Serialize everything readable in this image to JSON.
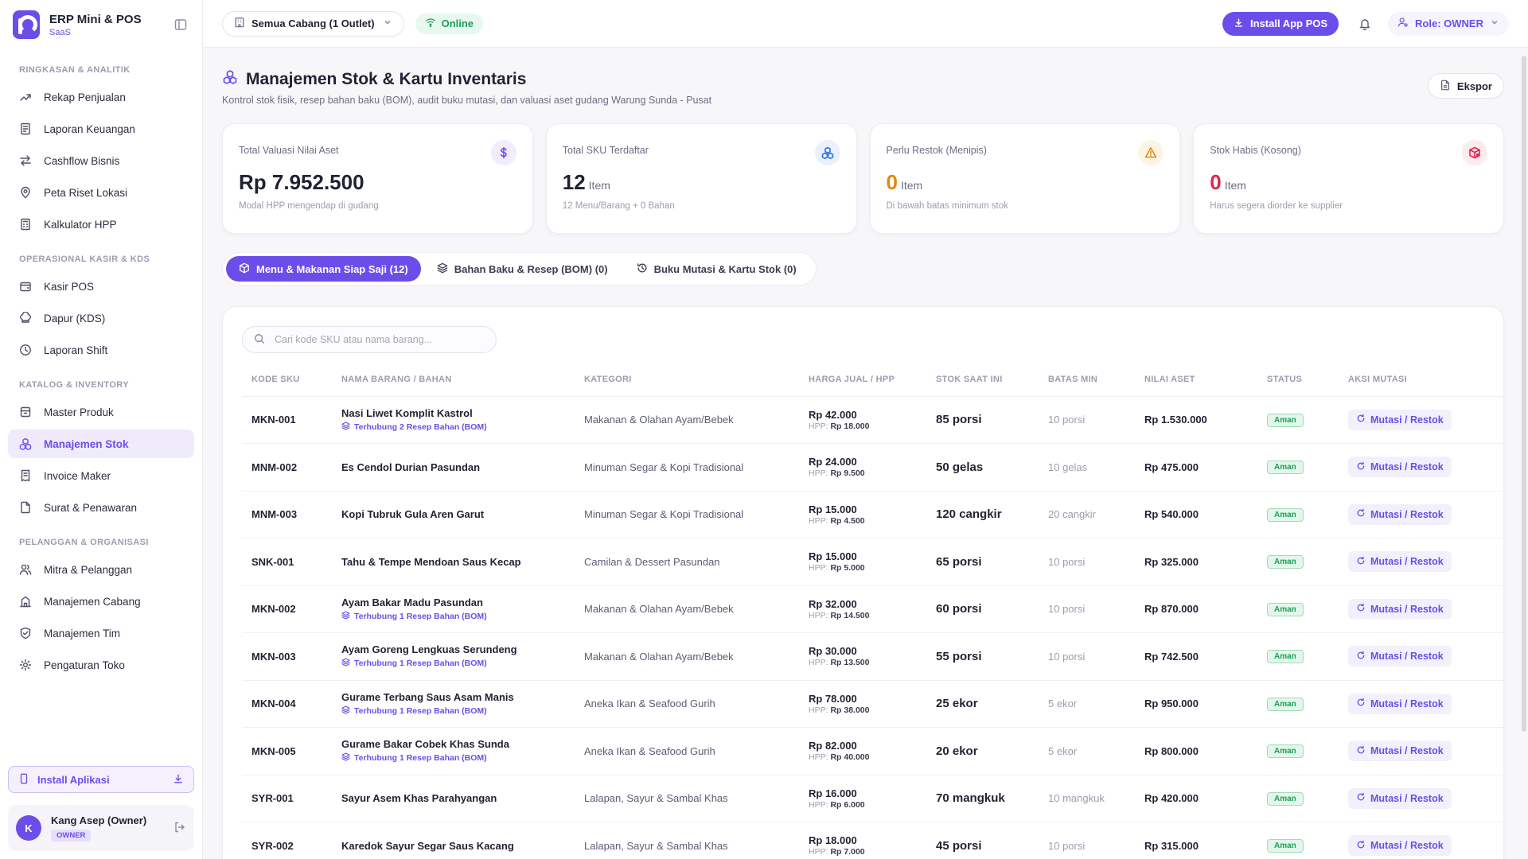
{
  "brand": {
    "title": "ERP Mini & POS",
    "subtitle": "SaaS"
  },
  "sidebar": {
    "sections": [
      {
        "title": "RINGKASAN & ANALITIK",
        "items": [
          {
            "label": "Rekap Penjualan",
            "icon": "trend-icon"
          },
          {
            "label": "Laporan Keuangan",
            "icon": "document-icon"
          },
          {
            "label": "Cashflow Bisnis",
            "icon": "transfer-icon"
          },
          {
            "label": "Peta Riset Lokasi",
            "icon": "map-pin-icon"
          },
          {
            "label": "Kalkulator HPP",
            "icon": "calculator-icon"
          }
        ]
      },
      {
        "title": "OPERASIONAL KASIR & KDS",
        "items": [
          {
            "label": "Kasir POS",
            "icon": "wallet-icon"
          },
          {
            "label": "Dapur (KDS)",
            "icon": "chef-hat-icon"
          },
          {
            "label": "Laporan Shift",
            "icon": "clock-icon"
          }
        ]
      },
      {
        "title": "KATALOG & INVENTORY",
        "items": [
          {
            "label": "Master Produk",
            "icon": "box-icon"
          },
          {
            "label": "Manajemen Stok",
            "icon": "boxes-icon"
          },
          {
            "label": "Invoice Maker",
            "icon": "receipt-icon"
          },
          {
            "label": "Surat & Penawaran",
            "icon": "file-icon"
          }
        ]
      },
      {
        "title": "PELANGGAN & ORGANISASI",
        "items": [
          {
            "label": "Mitra & Pelanggan",
            "icon": "users-icon"
          },
          {
            "label": "Manajemen Cabang",
            "icon": "building-icon"
          },
          {
            "label": "Manajemen Tim",
            "icon": "shield-icon"
          },
          {
            "label": "Pengaturan Toko",
            "icon": "gear-icon"
          }
        ]
      }
    ],
    "active_item": "Manajemen Stok",
    "install_label": "Install Aplikasi",
    "user": {
      "initial": "K",
      "name": "Kang Asep (Owner)",
      "role": "OWNER"
    }
  },
  "topbar": {
    "branch": "Semua Cabang (1 Outlet)",
    "status": "Online",
    "install_pos": "Install App POS",
    "role": "Role: OWNER"
  },
  "page": {
    "title": "Manajemen Stok & Kartu Inventaris",
    "description": "Kontrol stok fisik, resep bahan baku (BOM), audit buku mutasi, dan valuasi aset gudang Warung Sunda - Pusat",
    "export_label": "Ekspor"
  },
  "stats": [
    {
      "label": "Total Valuasi Nilai Aset",
      "value": "Rp 7.952.500",
      "unit": "",
      "note": "Modal HPP mengendap di gudang",
      "icon": "dollar-icon",
      "color": "#6b4eea",
      "bg": "#f1edfd",
      "value_color": "#1f2233"
    },
    {
      "label": "Total SKU Terdaftar",
      "value": "12",
      "unit": "Item",
      "note": "12 Menu/Barang + 0 Bahan",
      "icon": "boxes-icon",
      "color": "#2f6fe6",
      "bg": "#eaf1fd",
      "value_color": "#1f2233"
    },
    {
      "label": "Perlu Restok (Menipis)",
      "value": "0",
      "unit": "Item",
      "note": "Di bawah batas minimum stok",
      "icon": "warning-icon",
      "color": "#e08a12",
      "bg": "#fdf4e4",
      "value_color": "#e08a12"
    },
    {
      "label": "Stok Habis (Kosong)",
      "value": "0",
      "unit": "Item",
      "note": "Harus segera diorder ke supplier",
      "icon": "package-x-icon",
      "color": "#e0264a",
      "bg": "#fdebee",
      "value_color": "#e0264a"
    }
  ],
  "tabs": [
    {
      "label": "Menu & Makanan Siap Saji (12)",
      "icon": "package-icon",
      "active": true
    },
    {
      "label": "Bahan Baku & Resep (BOM) (0)",
      "icon": "layers-icon",
      "active": false
    },
    {
      "label": "Buku Mutasi & Kartu Stok (0)",
      "icon": "history-icon",
      "active": false
    }
  ],
  "search": {
    "placeholder": "Cari kode SKU atau nama barang..."
  },
  "table": {
    "columns": [
      "KODE SKU",
      "NAMA BARANG / BAHAN",
      "KATEGORI",
      "HARGA JUAL / HPP",
      "STOK SAAT INI",
      "BATAS MIN",
      "NILAI ASET",
      "STATUS",
      "AKSI MUTASI"
    ],
    "hpp_label": "HPP:",
    "action_label": "Mutasi / Restok",
    "rows": [
      {
        "sku": "MKN-001",
        "name": "Nasi Liwet Komplit Kastrol",
        "bom": "Terhubung 2 Resep Bahan (BOM)",
        "category": "Makanan & Olahan Ayam/Bebek",
        "price": "Rp 42.000",
        "hpp": "Rp 18.000",
        "stock": "85 porsi",
        "min": "10 porsi",
        "asset": "Rp 1.530.000",
        "status": "Aman"
      },
      {
        "sku": "MNM-002",
        "name": "Es Cendol Durian Pasundan",
        "bom": "",
        "category": "Minuman Segar & Kopi Tradisional",
        "price": "Rp 24.000",
        "hpp": "Rp 9.500",
        "stock": "50 gelas",
        "min": "10 gelas",
        "asset": "Rp 475.000",
        "status": "Aman"
      },
      {
        "sku": "MNM-003",
        "name": "Kopi Tubruk Gula Aren Garut",
        "bom": "",
        "category": "Minuman Segar & Kopi Tradisional",
        "price": "Rp 15.000",
        "hpp": "Rp 4.500",
        "stock": "120 cangkir",
        "min": "20 cangkir",
        "asset": "Rp 540.000",
        "status": "Aman"
      },
      {
        "sku": "SNK-001",
        "name": "Tahu & Tempe Mendoan Saus Kecap",
        "bom": "",
        "category": "Camilan & Dessert Pasundan",
        "price": "Rp 15.000",
        "hpp": "Rp 5.000",
        "stock": "65 porsi",
        "min": "10 porsi",
        "asset": "Rp 325.000",
        "status": "Aman"
      },
      {
        "sku": "MKN-002",
        "name": "Ayam Bakar Madu Pasundan",
        "bom": "Terhubung 1 Resep Bahan (BOM)",
        "category": "Makanan & Olahan Ayam/Bebek",
        "price": "Rp 32.000",
        "hpp": "Rp 14.500",
        "stock": "60 porsi",
        "min": "10 porsi",
        "asset": "Rp 870.000",
        "status": "Aman"
      },
      {
        "sku": "MKN-003",
        "name": "Ayam Goreng Lengkuas Serundeng",
        "bom": "Terhubung 1 Resep Bahan (BOM)",
        "category": "Makanan & Olahan Ayam/Bebek",
        "price": "Rp 30.000",
        "hpp": "Rp 13.500",
        "stock": "55 porsi",
        "min": "10 porsi",
        "asset": "Rp 742.500",
        "status": "Aman"
      },
      {
        "sku": "MKN-004",
        "name": "Gurame Terbang Saus Asam Manis",
        "bom": "Terhubung 1 Resep Bahan (BOM)",
        "category": "Aneka Ikan & Seafood Gurih",
        "price": "Rp 78.000",
        "hpp": "Rp 38.000",
        "stock": "25 ekor",
        "min": "5 ekor",
        "asset": "Rp 950.000",
        "status": "Aman"
      },
      {
        "sku": "MKN-005",
        "name": "Gurame Bakar Cobek Khas Sunda",
        "bom": "Terhubung 1 Resep Bahan (BOM)",
        "category": "Aneka Ikan & Seafood Gurih",
        "price": "Rp 82.000",
        "hpp": "Rp 40.000",
        "stock": "20 ekor",
        "min": "5 ekor",
        "asset": "Rp 800.000",
        "status": "Aman"
      },
      {
        "sku": "SYR-001",
        "name": "Sayur Asem Khas Parahyangan",
        "bom": "",
        "category": "Lalapan, Sayur & Sambal Khas",
        "price": "Rp 16.000",
        "hpp": "Rp 6.000",
        "stock": "70 mangkuk",
        "min": "10 mangkuk",
        "asset": "Rp 420.000",
        "status": "Aman"
      },
      {
        "sku": "SYR-002",
        "name": "Karedok Sayur Segar Saus Kacang",
        "bom": "",
        "category": "Lalapan, Sayur & Sambal Khas",
        "price": "Rp 18.000",
        "hpp": "Rp 7.000",
        "stock": "45 porsi",
        "min": "10 porsi",
        "asset": "Rp 315.000",
        "status": "Aman"
      }
    ]
  }
}
